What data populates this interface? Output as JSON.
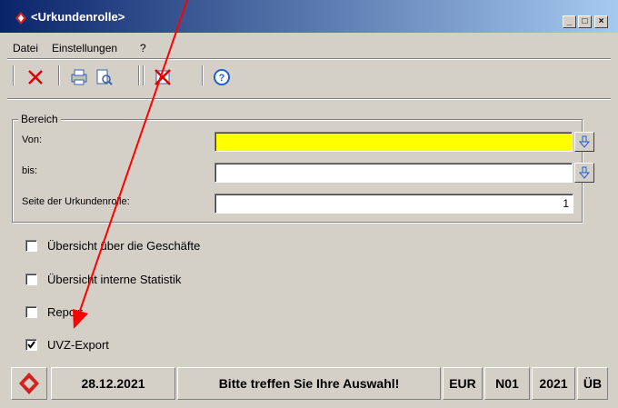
{
  "window": {
    "title": "<Urkundenrolle>"
  },
  "titlebar_buttons": {
    "minimize": "_",
    "maximize": "□",
    "close": "×"
  },
  "menu": {
    "items": [
      {
        "label": "Datei"
      },
      {
        "label": "Einstellungen"
      },
      {
        "label": "?"
      }
    ]
  },
  "toolbar": {
    "buttons": [
      "delete-x-icon",
      "printer-icon",
      "print-preview-icon",
      "crossed-out-icon",
      "help-icon"
    ]
  },
  "range": {
    "group_label": "Bereich",
    "from_label": "Von:",
    "from_value": "",
    "to_label": "bis:",
    "to_value": "",
    "page_label": "Seite der Urkundenrolle:",
    "page_value": "1"
  },
  "options": [
    {
      "label": "Übersicht über die Geschäfte",
      "checked": false
    },
    {
      "label": "Übersicht interne Statistik",
      "checked": false
    },
    {
      "label": "Report",
      "checked": false
    },
    {
      "label": "UVZ-Export",
      "checked": true
    }
  ],
  "status": {
    "date": "28.12.2021",
    "message": "Bitte treffen Sie Ihre Auswahl!",
    "currency": "EUR",
    "code": "N01",
    "year": "2021",
    "mode": "ÜB"
  },
  "colors": {
    "title_gradient_start": "#0a246a",
    "title_gradient_end": "#a6caf0",
    "required_field": "#ffff00",
    "annotation_arrow": "#ff0000"
  }
}
